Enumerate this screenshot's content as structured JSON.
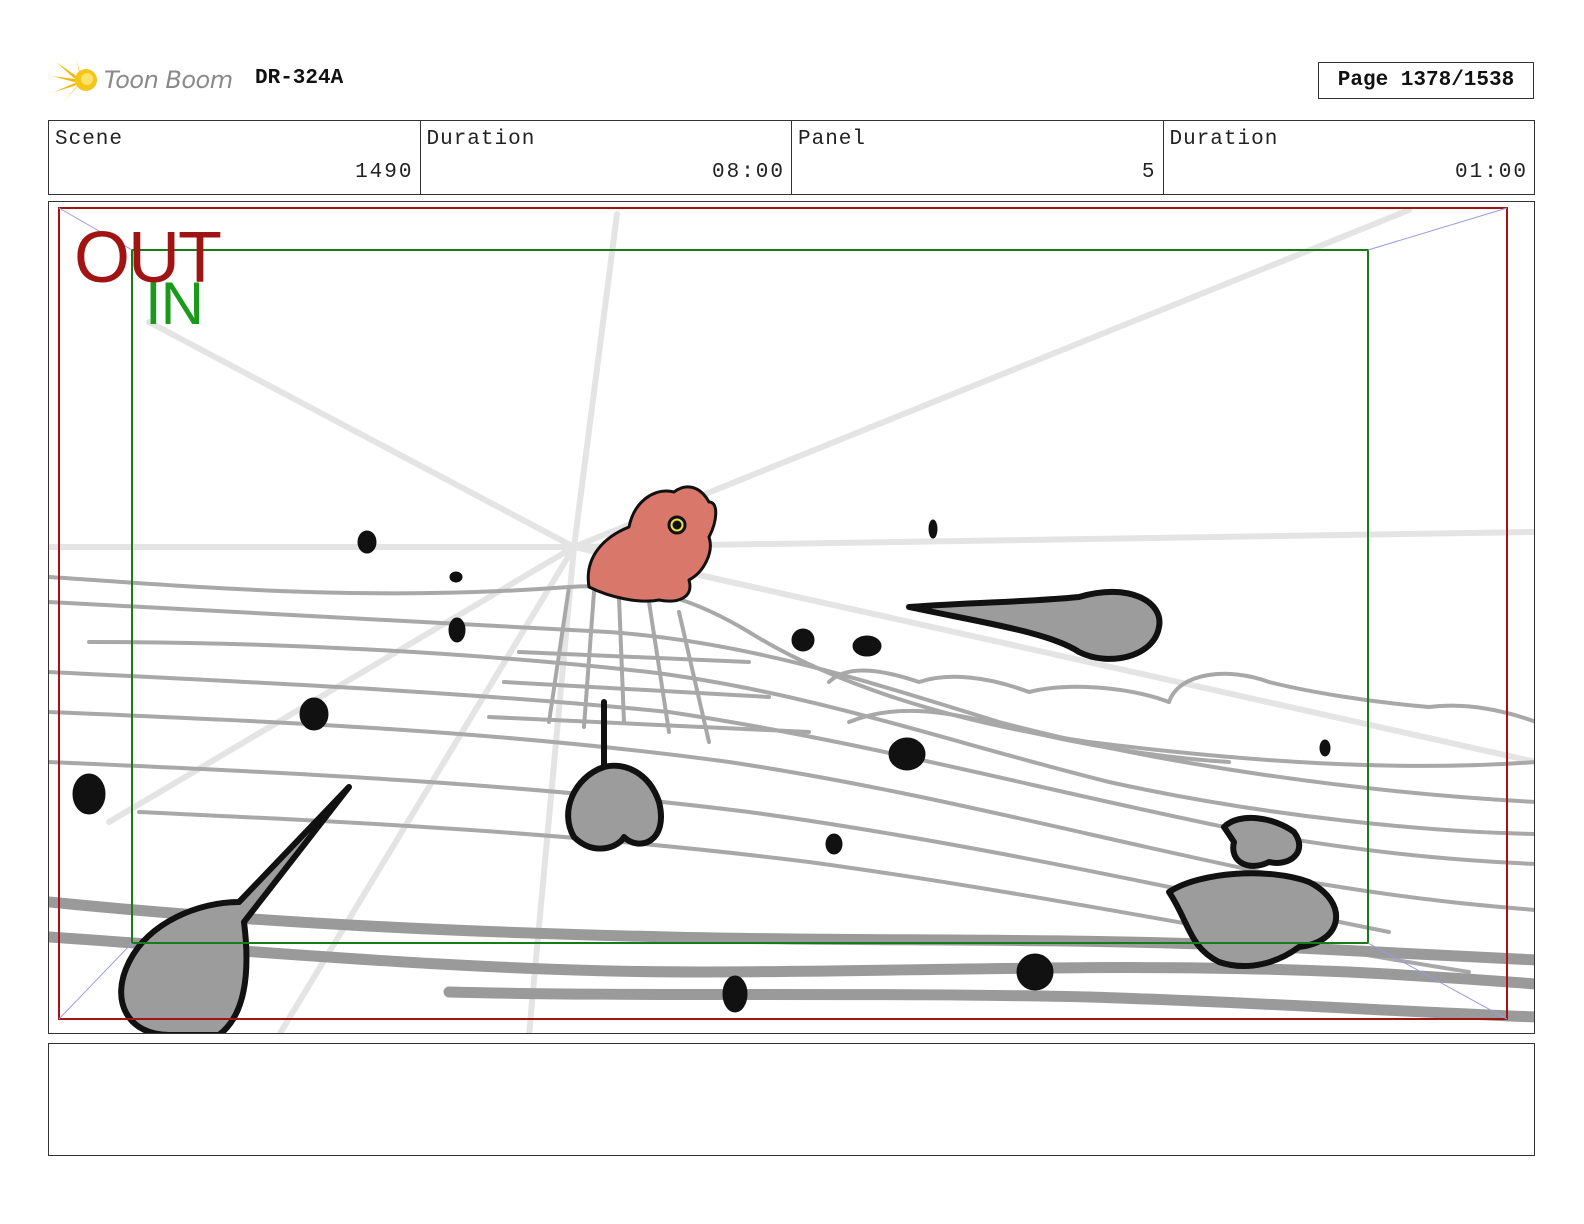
{
  "header": {
    "logo_text": "Toon Boom",
    "doc_id": "DR-324A",
    "page_label": "Page 1378/1538"
  },
  "info": [
    {
      "label": "Scene",
      "value": "1490"
    },
    {
      "label": "Duration",
      "value": "08:00"
    },
    {
      "label": "Panel",
      "value": "5"
    },
    {
      "label": "Duration",
      "value": "01:00"
    }
  ],
  "panel": {
    "out_label": "OUT",
    "in_label": "IN"
  },
  "colors": {
    "out_frame": "#a11414",
    "in_frame": "#1a7a1a",
    "creature_fill": "#d9776a",
    "sketch_gray": "#9a9a9a"
  },
  "icons": [
    "toon-boom-logo-icon"
  ]
}
